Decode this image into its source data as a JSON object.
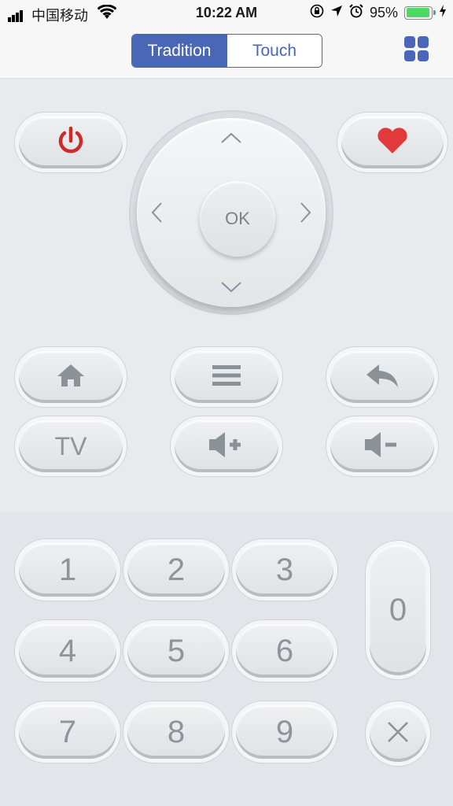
{
  "status_bar": {
    "carrier": "中国移动",
    "time": "10:22 AM",
    "battery": "95%",
    "battery_level": 0.95
  },
  "mode_switch": {
    "tabs": [
      "Tradition",
      "Touch"
    ],
    "selected": "Tradition"
  },
  "grid_menu_icon": "grid-icon",
  "dpad": {
    "ok_label": "OK"
  },
  "buttons": {
    "tv_label": "TV"
  },
  "keypad": {
    "digits": [
      "1",
      "2",
      "3",
      "4",
      "5",
      "6",
      "7",
      "8",
      "9",
      "0"
    ]
  },
  "colors": {
    "accent": "#4a66b6",
    "power": "#cc2b2b",
    "heart": "#e03a3a"
  }
}
